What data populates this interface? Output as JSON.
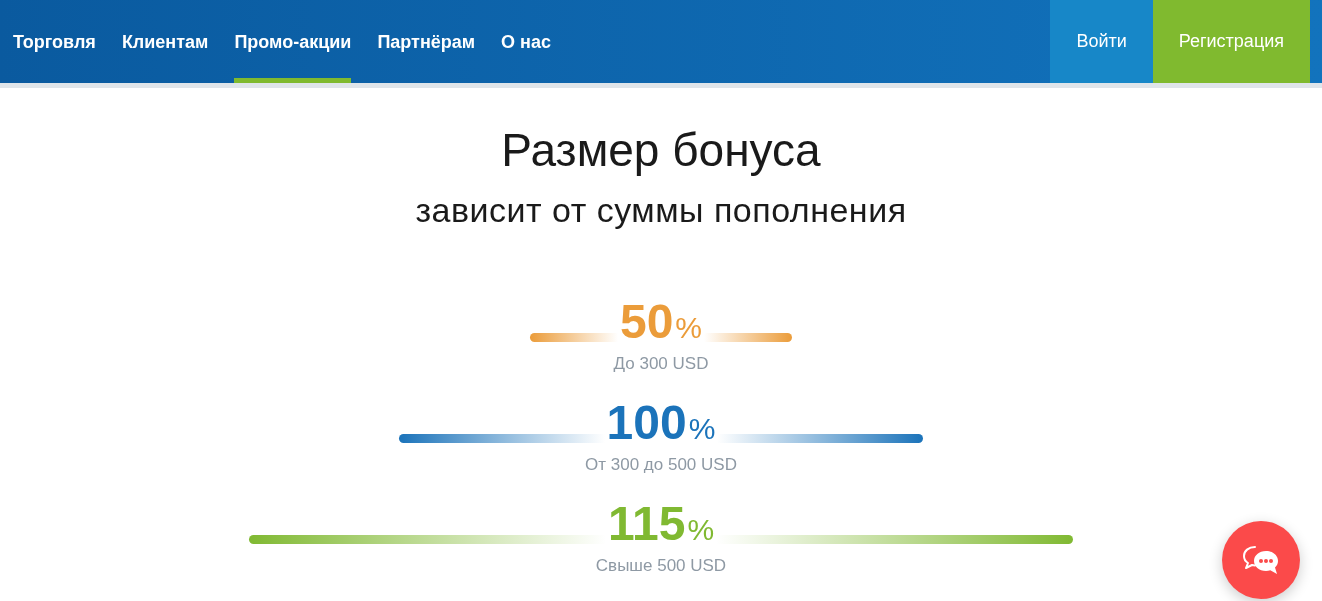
{
  "nav": {
    "items": [
      {
        "label": "Торговля",
        "selected": false
      },
      {
        "label": "Клиентам",
        "selected": false
      },
      {
        "label": "Промо-акции",
        "selected": true
      },
      {
        "label": "Партнёрам",
        "selected": false
      },
      {
        "label": "О нас",
        "selected": false
      }
    ]
  },
  "auth": [
    {
      "label": "Войти",
      "kind": "login"
    },
    {
      "label": "Регистрация",
      "kind": "register"
    }
  ],
  "hero": {
    "title": "Размер бонуса",
    "subtitle": "зависит от суммы пополнения"
  },
  "tiers": [
    {
      "value": "50",
      "unit": "%",
      "range": "До 300 USD",
      "color": "#eb9c3a"
    },
    {
      "value": "100",
      "unit": "%",
      "range": "От 300 до 500 USD",
      "color": "#1b73ba"
    },
    {
      "value": "115",
      "unit": "%",
      "range": "Свыше 500 USD",
      "color": "#80b932"
    }
  ]
}
